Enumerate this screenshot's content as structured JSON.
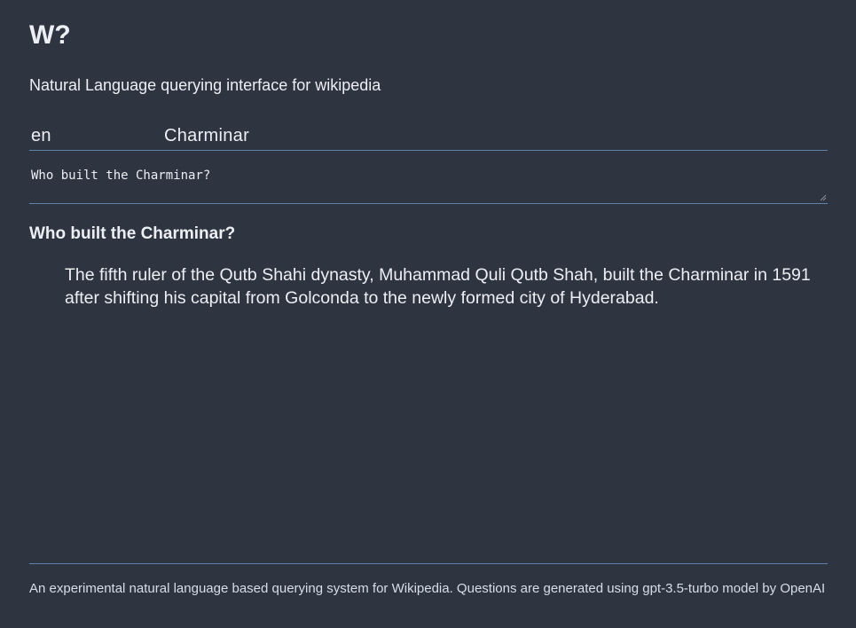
{
  "app": {
    "title": "W?",
    "subtitle": "Natural Language querying interface for wikipedia"
  },
  "query": {
    "language": "en",
    "article": "Charminar",
    "question": "Who built the Charminar?"
  },
  "answer": {
    "question": "Who built the Charminar?",
    "text": "The fifth ruler of the Qutb Shahi dynasty, Muhammad Quli Qutb Shah, built the Charminar in 1591 after shifting his capital from Golconda to the newly formed city of Hyderabad."
  },
  "footer": {
    "text": "An experimental natural language based querying system for Wikipedia. Questions are generated using gpt-3.5-turbo model by OpenAI"
  },
  "colors": {
    "background": "#2e3440",
    "text": "#eceff4",
    "accent_line": "#5e81ac"
  }
}
